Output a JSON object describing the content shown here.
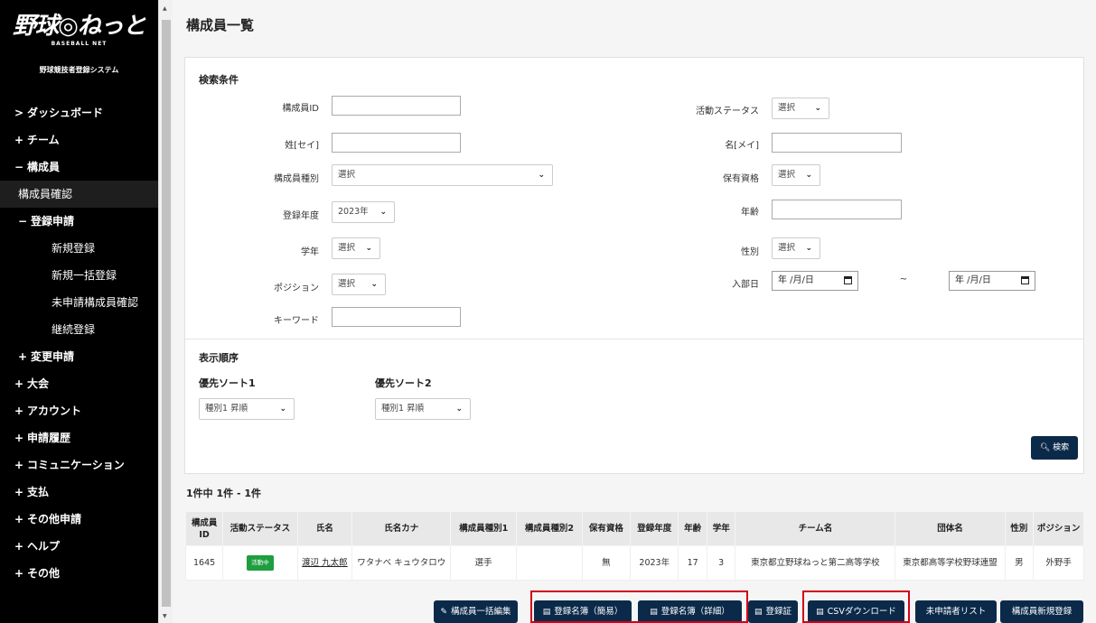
{
  "sidebar": {
    "logo_text": "野球◎ねっと",
    "logo_sub": "BASEBALL NET",
    "system_name": "野球競技者登録システム",
    "items": [
      {
        "sym": ">",
        "label": "ダッシュボード"
      },
      {
        "sym": "+",
        "label": "チーム"
      },
      {
        "sym": "−",
        "label": "構成員"
      },
      {
        "sym": "",
        "label": "構成員確認"
      },
      {
        "sym": "−",
        "label": "登録申請"
      },
      {
        "sym": "",
        "label": "新規登録"
      },
      {
        "sym": "",
        "label": "新規一括登録"
      },
      {
        "sym": "",
        "label": "未申請構成員確認"
      },
      {
        "sym": "",
        "label": "継続登録"
      },
      {
        "sym": "+",
        "label": "変更申請"
      },
      {
        "sym": "+",
        "label": "大会"
      },
      {
        "sym": "+",
        "label": "アカウント"
      },
      {
        "sym": "+",
        "label": "申請履歴"
      },
      {
        "sym": "+",
        "label": "コミュニケーション"
      },
      {
        "sym": "+",
        "label": "支払"
      },
      {
        "sym": "+",
        "label": "その他申請"
      },
      {
        "sym": "+",
        "label": "ヘルプ"
      },
      {
        "sym": "+",
        "label": "その他"
      }
    ]
  },
  "page": {
    "title": "構成員一覧",
    "search": {
      "title": "検索条件",
      "member_id": "構成員ID",
      "last_name": "姓[セイ]",
      "first_name": "名[メイ]",
      "activity_status": "活動ステータス",
      "member_type": "構成員種別",
      "qualification": "保有資格",
      "reg_year": "登録年度",
      "age": "年齢",
      "grade": "学年",
      "gender": "性別",
      "position": "ポジション",
      "join_date": "入部日",
      "keyword": "キーワード",
      "select": "選択",
      "year_value": "2023年",
      "date_placeholder": "年 /月/日",
      "tilde": "~"
    },
    "sort": {
      "title": "表示順序",
      "sort1_label": "優先ソート1",
      "sort2_label": "優先ソート2",
      "sort1_value": "種別1 昇順",
      "sort2_value": "種別1 昇順"
    },
    "search_button": "検索",
    "result_count": "1件中 1件 - 1件"
  },
  "table": {
    "headers": [
      "構成員ID",
      "活動ステータス",
      "氏名",
      "氏名カナ",
      "構成員種別1",
      "構成員種別2",
      "保有資格",
      "登録年度",
      "年齢",
      "学年",
      "チーム名",
      "団体名",
      "性別",
      "ポジション"
    ],
    "rows": [
      {
        "id": "1645",
        "status": "活動中",
        "name": "渡辺 九太郎",
        "kana": "ワタナベ キュウタロウ",
        "type1": "選手",
        "type2": "",
        "qualification": "無",
        "year": "2023年",
        "age": "17",
        "grade": "3",
        "team": "東京都立野球ねっと第二高等学校",
        "org": "東京都高等学校野球連盟",
        "gender": "男",
        "position": "外野手"
      }
    ]
  },
  "buttons": {
    "bulk_edit": "構成員一括編集",
    "roster_simple": "登録名簿（簡易）",
    "roster_detail": "登録名簿（詳細）",
    "certificate": "登録証",
    "csv": "CSVダウンロード",
    "unapplied": "未申請者リスト",
    "new_member": "構成員新規登録"
  },
  "colors": {
    "sidebar_bg": "#000000",
    "button_bg": "#0b2a4a",
    "badge_green": "#1e9e3e",
    "highlight_red": "#d0021b"
  }
}
